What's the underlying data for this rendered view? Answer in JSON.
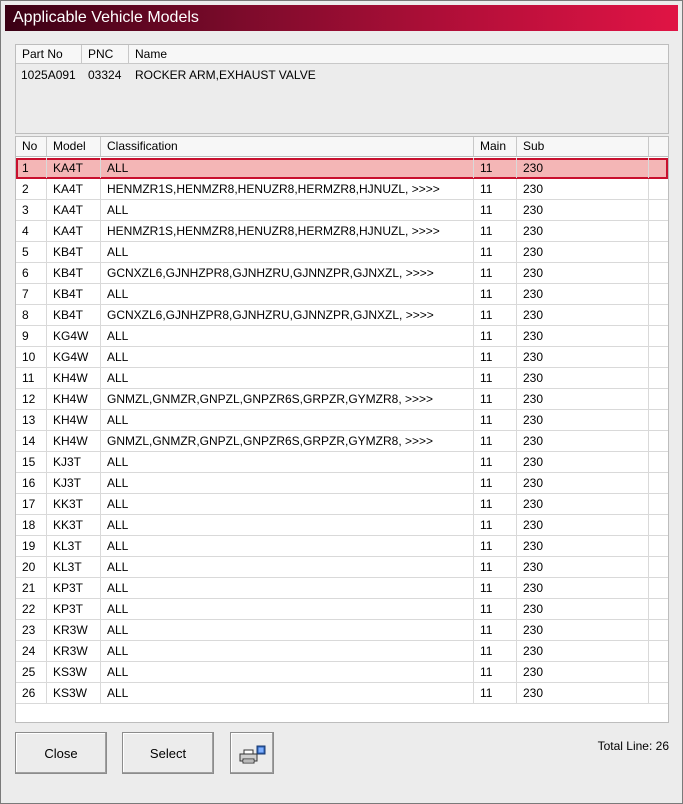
{
  "window": {
    "title": "Applicable Vehicle Models"
  },
  "part_panel": {
    "headers": {
      "part_no": "Part No",
      "pnc": "PNC",
      "name": "Name"
    },
    "values": {
      "part_no": "1025A091",
      "pnc": "03324",
      "name": "ROCKER ARM,EXHAUST VALVE"
    }
  },
  "grid": {
    "headers": {
      "no": "No",
      "model": "Model",
      "classification": "Classification",
      "main": "Main",
      "sub": "Sub"
    },
    "selected_index": 0,
    "rows": [
      {
        "no": "1",
        "model": "KA4T",
        "classification": "ALL",
        "main": "11",
        "sub": "230"
      },
      {
        "no": "2",
        "model": "KA4T",
        "classification": "HENMZR1S,HENMZR8,HENUZR8,HERMZR8,HJNUZL,  >>>>",
        "main": "11",
        "sub": "230"
      },
      {
        "no": "3",
        "model": "KA4T",
        "classification": "ALL",
        "main": "11",
        "sub": "230"
      },
      {
        "no": "4",
        "model": "KA4T",
        "classification": "HENMZR1S,HENMZR8,HENUZR8,HERMZR8,HJNUZL,  >>>>",
        "main": "11",
        "sub": "230"
      },
      {
        "no": "5",
        "model": "KB4T",
        "classification": "ALL",
        "main": "11",
        "sub": "230"
      },
      {
        "no": "6",
        "model": "KB4T",
        "classification": "GCNXZL6,GJNHZPR8,GJNHZRU,GJNNZPR,GJNXZL,  >>>>",
        "main": "11",
        "sub": "230"
      },
      {
        "no": "7",
        "model": "KB4T",
        "classification": "ALL",
        "main": "11",
        "sub": "230"
      },
      {
        "no": "8",
        "model": "KB4T",
        "classification": "GCNXZL6,GJNHZPR8,GJNHZRU,GJNNZPR,GJNXZL,  >>>>",
        "main": "11",
        "sub": "230"
      },
      {
        "no": "9",
        "model": "KG4W",
        "classification": "ALL",
        "main": "11",
        "sub": "230"
      },
      {
        "no": "10",
        "model": "KG4W",
        "classification": "ALL",
        "main": "11",
        "sub": "230"
      },
      {
        "no": "11",
        "model": "KH4W",
        "classification": "ALL",
        "main": "11",
        "sub": "230"
      },
      {
        "no": "12",
        "model": "KH4W",
        "classification": "GNMZL,GNMZR,GNPZL,GNPZR6S,GRPZR,GYMZR8,  >>>>",
        "main": "11",
        "sub": "230"
      },
      {
        "no": "13",
        "model": "KH4W",
        "classification": "ALL",
        "main": "11",
        "sub": "230"
      },
      {
        "no": "14",
        "model": "KH4W",
        "classification": "GNMZL,GNMZR,GNPZL,GNPZR6S,GRPZR,GYMZR8,  >>>>",
        "main": "11",
        "sub": "230"
      },
      {
        "no": "15",
        "model": "KJ3T",
        "classification": "ALL",
        "main": "11",
        "sub": "230"
      },
      {
        "no": "16",
        "model": "KJ3T",
        "classification": "ALL",
        "main": "11",
        "sub": "230"
      },
      {
        "no": "17",
        "model": "KK3T",
        "classification": "ALL",
        "main": "11",
        "sub": "230"
      },
      {
        "no": "18",
        "model": "KK3T",
        "classification": "ALL",
        "main": "11",
        "sub": "230"
      },
      {
        "no": "19",
        "model": "KL3T",
        "classification": "ALL",
        "main": "11",
        "sub": "230"
      },
      {
        "no": "20",
        "model": "KL3T",
        "classification": "ALL",
        "main": "11",
        "sub": "230"
      },
      {
        "no": "21",
        "model": "KP3T",
        "classification": "ALL",
        "main": "11",
        "sub": "230"
      },
      {
        "no": "22",
        "model": "KP3T",
        "classification": "ALL",
        "main": "11",
        "sub": "230"
      },
      {
        "no": "23",
        "model": "KR3W",
        "classification": "ALL",
        "main": "11",
        "sub": "230"
      },
      {
        "no": "24",
        "model": "KR3W",
        "classification": "ALL",
        "main": "11",
        "sub": "230"
      },
      {
        "no": "25",
        "model": "KS3W",
        "classification": "ALL",
        "main": "11",
        "sub": "230"
      },
      {
        "no": "26",
        "model": "KS3W",
        "classification": "ALL",
        "main": "11",
        "sub": "230"
      }
    ]
  },
  "buttons": {
    "close": "Close",
    "select": "Select",
    "print_icon": "printer-icon"
  },
  "footer": {
    "total_line": "Total Line: 26"
  },
  "colors": {
    "selection_fill": "#f4b6b6",
    "selection_border": "#c8102e",
    "title_gradient_end": "#e01445"
  }
}
